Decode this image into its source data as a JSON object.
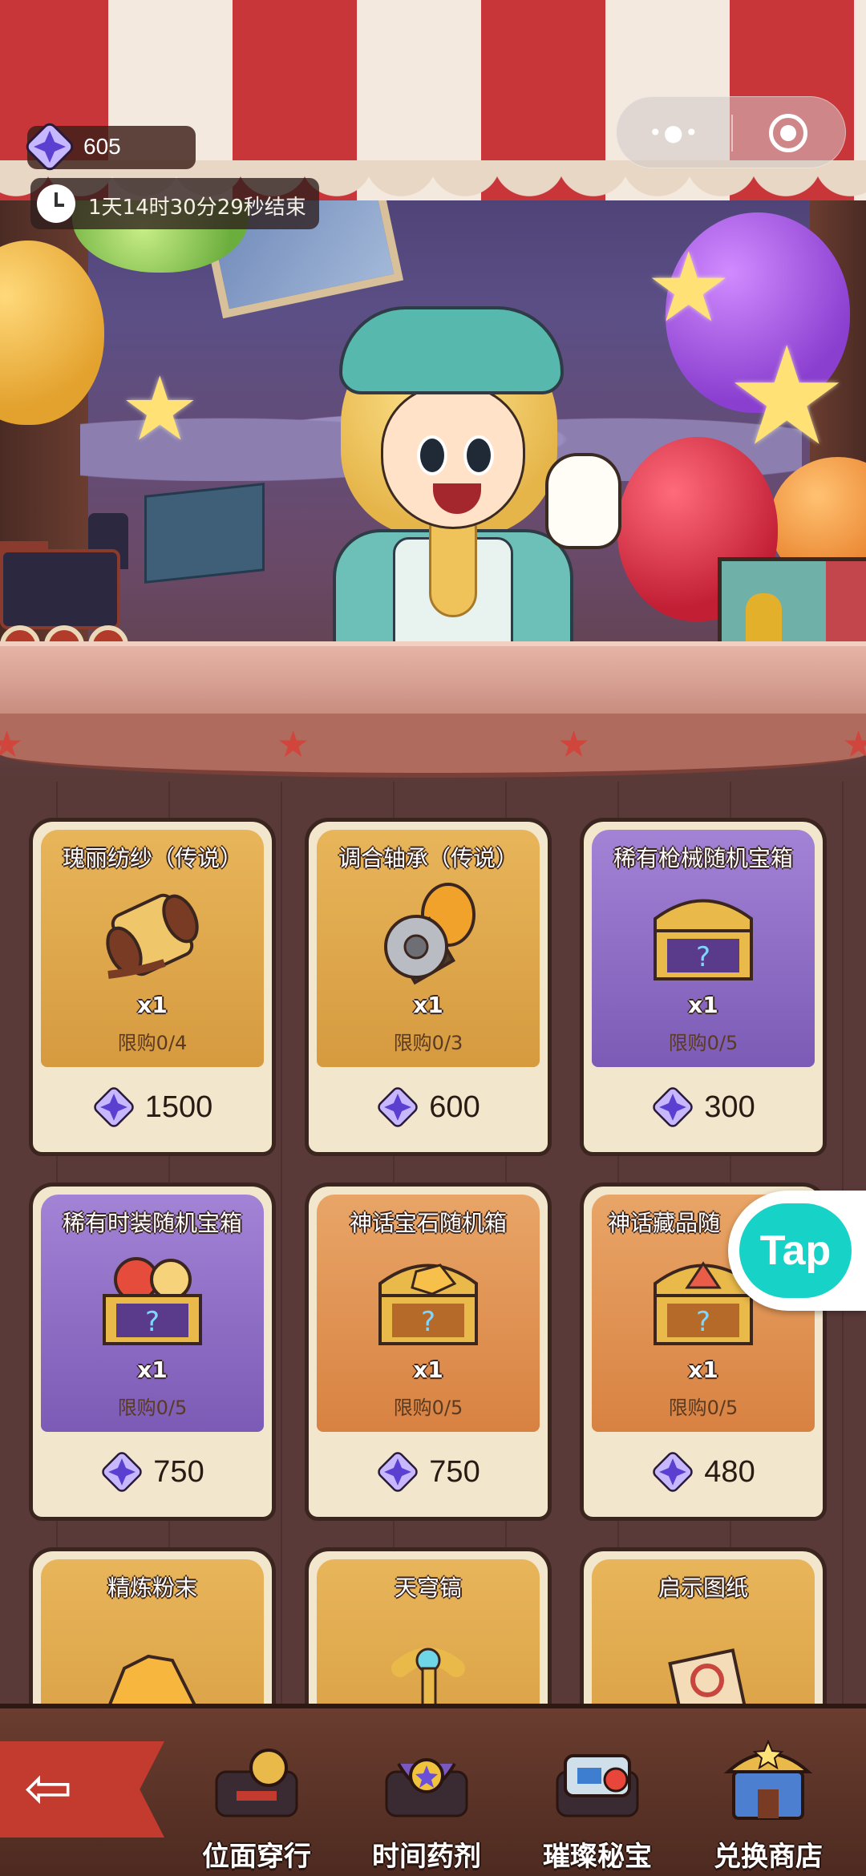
{
  "hud": {
    "gem_count": "605",
    "timer_text": "1天14时30分29秒结束"
  },
  "colors": {
    "gem": "#6b4fd8",
    "card_gold": "#e8b55a",
    "card_purple": "#a283d6",
    "card_orange": "#e8a567",
    "nav_back": "#c33a2e"
  },
  "shop_items": [
    {
      "title": "瑰丽纺纱（传说）",
      "qty": "x1",
      "limit": "限购0/4",
      "price": "1500",
      "icon": "golden-spool-icon",
      "style": "gold"
    },
    {
      "title": "调合轴承（传说）",
      "qty": "x1",
      "limit": "限购0/3",
      "price": "600",
      "icon": "gear-bearing-icon",
      "style": "gold"
    },
    {
      "title": "稀有枪械随机宝箱",
      "qty": "x1",
      "limit": "限购0/5",
      "price": "300",
      "icon": "treasure-chest-icon",
      "style": "purple"
    },
    {
      "title": "稀有时装随机宝箱",
      "qty": "x1",
      "limit": "限购0/5",
      "price": "750",
      "icon": "costume-chest-icon",
      "style": "purple"
    },
    {
      "title": "神话宝石随机箱",
      "qty": "x1",
      "limit": "限购0/5",
      "price": "750",
      "icon": "gem-chest-icon",
      "style": "orange"
    },
    {
      "title": "神话藏品随",
      "qty": "x1",
      "limit": "限购0/5",
      "price": "480",
      "icon": "relic-chest-icon",
      "style": "orange"
    },
    {
      "title": "精炼粉末",
      "icon": "refined-powder-icon",
      "style": "gold"
    },
    {
      "title": "天穹镐",
      "icon": "sky-pickaxe-icon",
      "style": "gold"
    },
    {
      "title": "启示图纸",
      "icon": "blueprint-scroll-icon",
      "style": "gold"
    }
  ],
  "floating_badge": {
    "label": "Tap"
  },
  "nav": {
    "back_icon": "back-arrow-icon",
    "items": [
      {
        "label": "位面穿行",
        "icon": "plane-travel-icon"
      },
      {
        "label": "时间药剂",
        "icon": "time-potion-icon"
      },
      {
        "label": "璀璨秘宝",
        "icon": "dazzling-treasure-icon"
      },
      {
        "label": "兑换商店",
        "icon": "exchange-shop-icon"
      }
    ]
  }
}
